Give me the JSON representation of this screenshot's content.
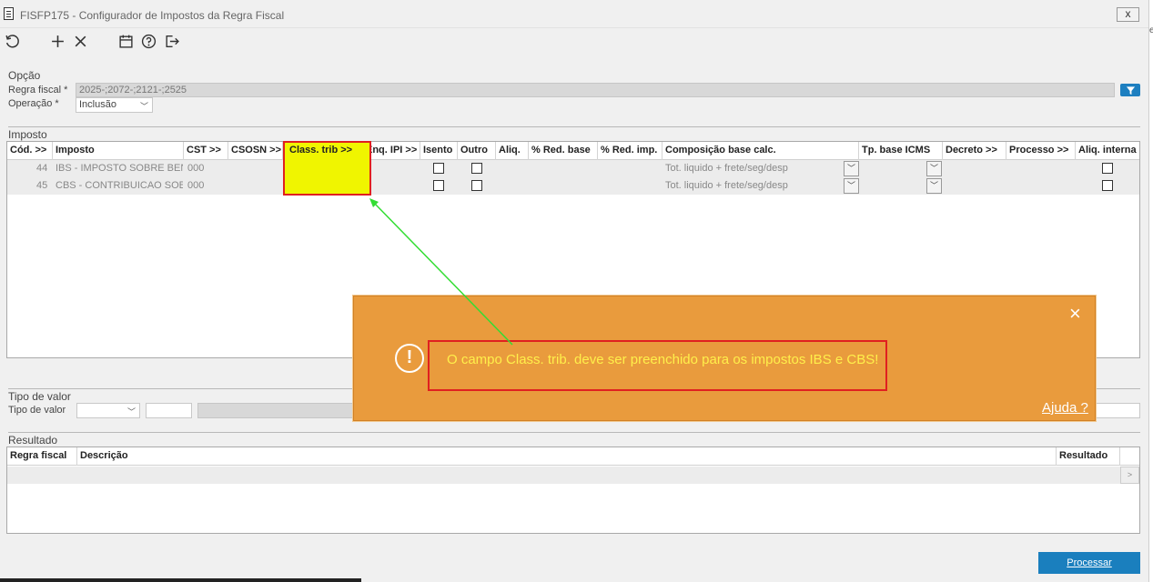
{
  "window": {
    "title": "FISFP175 - Configurador de Impostos da Regra Fiscal",
    "close_label": "x"
  },
  "toolbar": {
    "icons": [
      "refresh-icon",
      "add-icon",
      "delete-icon",
      "calendar-icon",
      "help-icon",
      "exit-icon"
    ]
  },
  "opcao": {
    "section": "Opção",
    "regra_label": "Regra fiscal *",
    "regra_value": "2025-;2072-;2121-;2525",
    "operacao_label": "Operação *",
    "operacao_value": "Inclusão"
  },
  "imposto": {
    "section": "Imposto",
    "columns": [
      "Cód. >>",
      "Imposto",
      "CST >>",
      "CSOSN >>",
      "Class. trib >>",
      "Enq. IPI >>",
      "Isento",
      "Outro",
      "Aliq.",
      "% Red. base",
      "% Red. imp.",
      "Composição base calc.",
      "Tp. base ICMS",
      "Decreto >>",
      "Processo >>",
      "Aliq. interna"
    ],
    "rows": [
      {
        "cod": "44",
        "imposto": "IBS - IMPOSTO SOBRE BENS",
        "cst": "000",
        "composicao": "Tot. liquido + frete/seg/desp"
      },
      {
        "cod": "45",
        "imposto": "CBS - CONTRIBUICAO SOBRI",
        "cst": "000",
        "composicao": "Tot. liquido + frete/seg/desp"
      }
    ]
  },
  "tipo_valor": {
    "section": "Tipo de valor",
    "label": "Tipo de valor"
  },
  "resultado": {
    "section": "Resultado",
    "columns": [
      "Regra fiscal",
      "Descrição",
      "Resultado"
    ],
    "scroll_label": ">"
  },
  "actions": {
    "process_label": "Processar"
  },
  "toast": {
    "message": "O campo Class. trib. deve ser preenchido para os impostos IBS e CBS!",
    "help_label": "Ajuda ?",
    "close_label": "×",
    "icon_label": "!"
  },
  "colors": {
    "accent": "#1a7fbe",
    "toast": "#e99b3d",
    "highlight": "#f0f500",
    "annotation": "#e02020",
    "arrow": "#33dd33"
  }
}
